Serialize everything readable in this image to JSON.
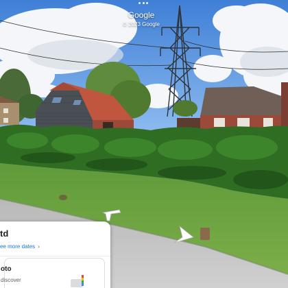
{
  "watermark": {
    "brand": "Google",
    "copyright": "© 2023 Google"
  },
  "info_card": {
    "title": "td",
    "see_dates_link": "ee more dates",
    "chevron_icon": "chevron-right-icon"
  },
  "photo_card": {
    "title": "oto",
    "subtitle": "discover",
    "icon": "photo-stack-icon"
  },
  "navigation": {
    "arrows": [
      "nav-arrow-back",
      "nav-arrow-forward"
    ]
  },
  "colors": {
    "sky": "#4f8fe0",
    "hedge": "#2f6e22",
    "grass": "#6fa443",
    "road": "#c4c4c4",
    "roof_tiles": "#c0563d",
    "brick": "#9b4a3a",
    "link_blue": "#1a73e8"
  }
}
